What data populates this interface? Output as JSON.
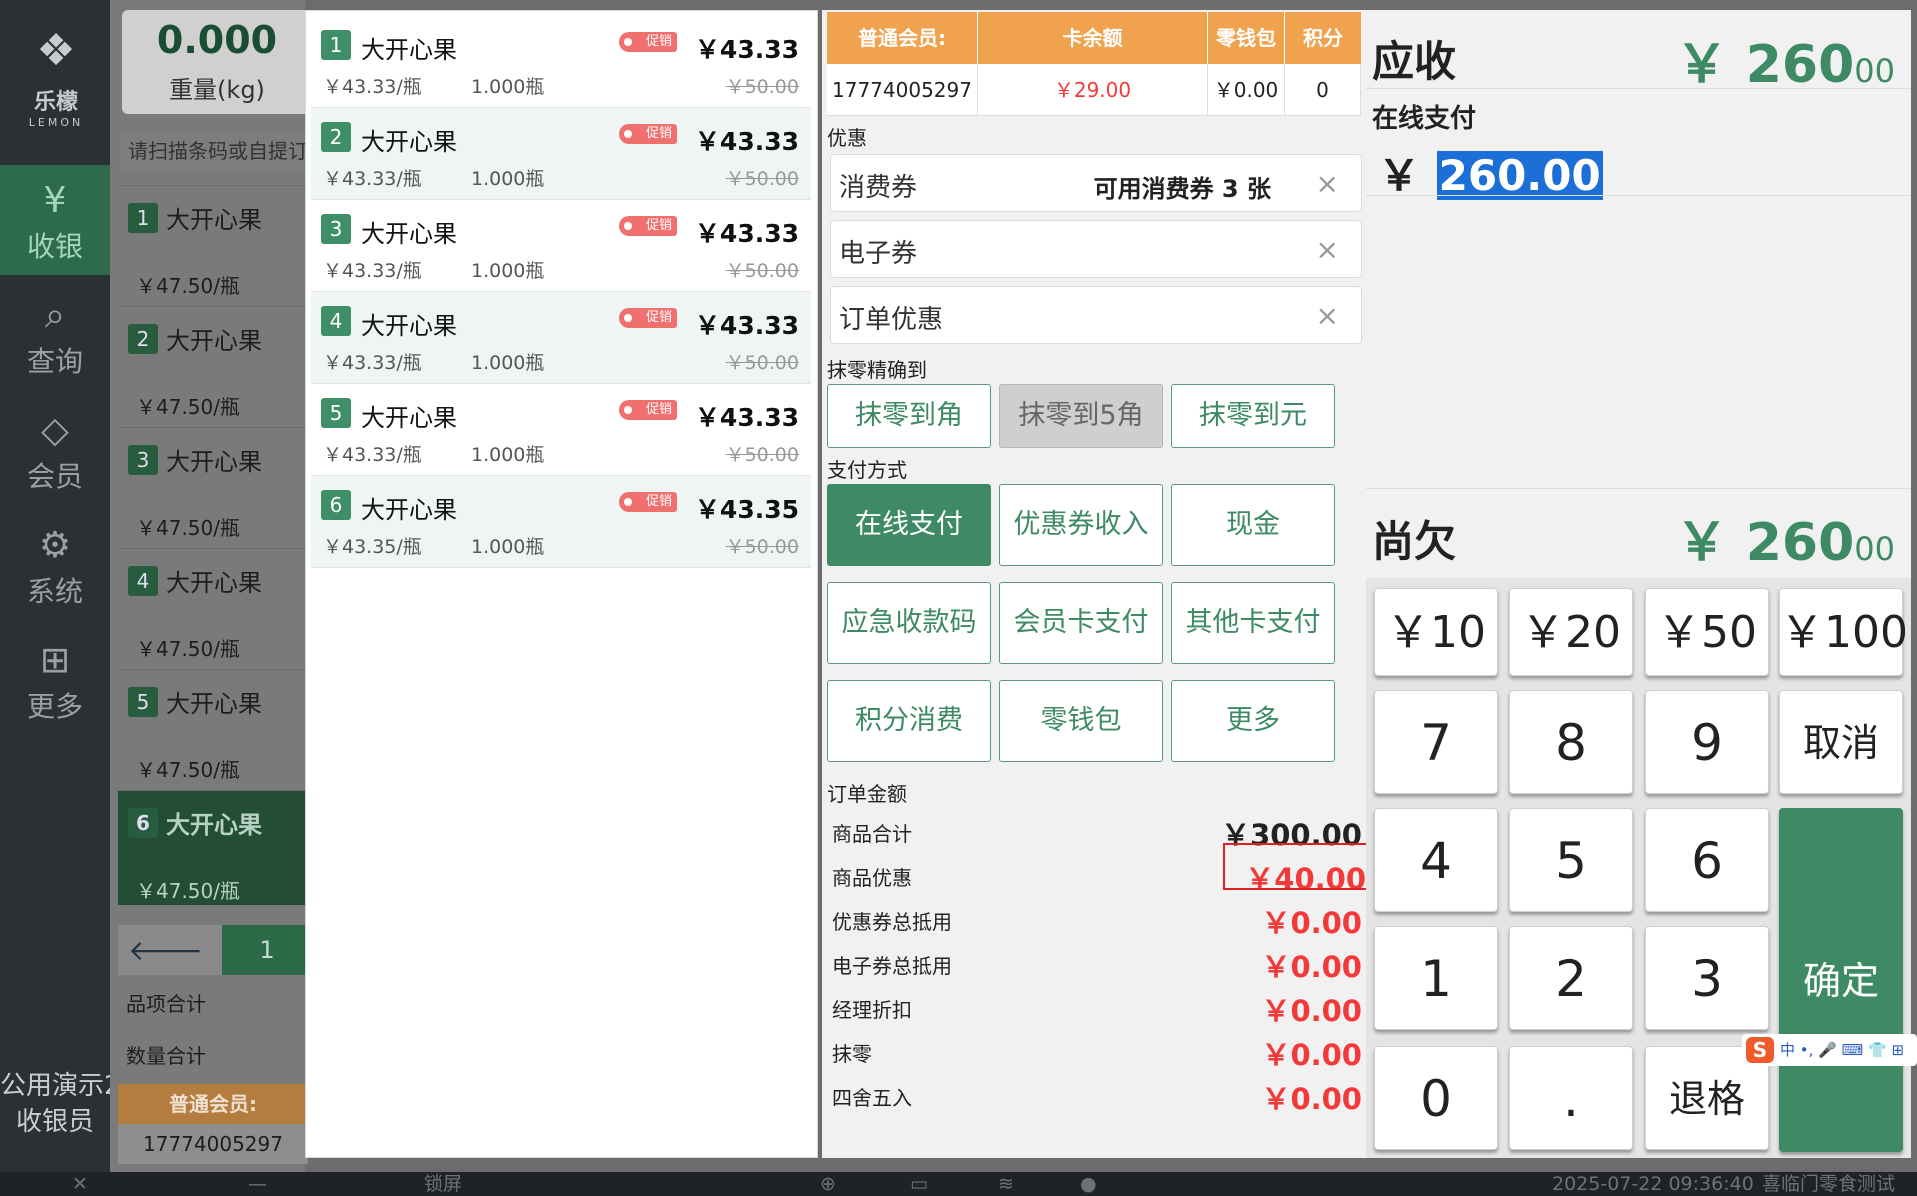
{
  "sidebar": {
    "logo_cn": "乐檬",
    "logo_en": "LEMON",
    "items": [
      {
        "label": "收银",
        "icon": "cashier-icon",
        "glyph": "¥",
        "active": true
      },
      {
        "label": "查询",
        "icon": "search-icon",
        "glyph": "⌕",
        "active": false
      },
      {
        "label": "会员",
        "icon": "diamond-icon",
        "glyph": "◇",
        "active": false
      },
      {
        "label": "系统",
        "icon": "gear-icon",
        "glyph": "⚙",
        "active": false
      },
      {
        "label": "更多",
        "icon": "grid-icon",
        "glyph": "⊞",
        "active": false
      }
    ],
    "store": "公用演示2",
    "role": "收银员"
  },
  "background": {
    "weight_value": "0.000",
    "weight_unit": "重量(kg)",
    "search_placeholder": "请扫描条码或自提订",
    "items": [
      {
        "no": "1",
        "name": "大开心果",
        "price": "￥47.50/瓶"
      },
      {
        "no": "2",
        "name": "大开心果",
        "price": "￥47.50/瓶"
      },
      {
        "no": "3",
        "name": "大开心果",
        "price": "￥47.50/瓶"
      },
      {
        "no": "4",
        "name": "大开心果",
        "price": "￥47.50/瓶"
      },
      {
        "no": "5",
        "name": "大开心果",
        "price": "￥47.50/瓶"
      },
      {
        "no": "6",
        "name": "大开心果",
        "price": "￥47.50/瓶"
      }
    ],
    "page": "1",
    "sum_items_label": "品项合计",
    "sum_qty_label": "数量合计",
    "member_label": "普通会员:",
    "member_phone": "17774005297"
  },
  "cart": [
    {
      "no": "1",
      "name": "大开心果",
      "tag": "促销",
      "price": "￥43.33",
      "unit": "￥43.33/瓶",
      "qty": "1.000瓶",
      "orig": "￥50.00"
    },
    {
      "no": "2",
      "name": "大开心果",
      "tag": "促销",
      "price": "￥43.33",
      "unit": "￥43.33/瓶",
      "qty": "1.000瓶",
      "orig": "￥50.00"
    },
    {
      "no": "3",
      "name": "大开心果",
      "tag": "促销",
      "price": "￥43.33",
      "unit": "￥43.33/瓶",
      "qty": "1.000瓶",
      "orig": "￥50.00"
    },
    {
      "no": "4",
      "name": "大开心果",
      "tag": "促销",
      "price": "￥43.33",
      "unit": "￥43.33/瓶",
      "qty": "1.000瓶",
      "orig": "￥50.00"
    },
    {
      "no": "5",
      "name": "大开心果",
      "tag": "促销",
      "price": "￥43.33",
      "unit": "￥43.33/瓶",
      "qty": "1.000瓶",
      "orig": "￥50.00"
    },
    {
      "no": "6",
      "name": "大开心果",
      "tag": "促销",
      "price": "￥43.35",
      "unit": "￥43.35/瓶",
      "qty": "1.000瓶",
      "orig": "￥50.00"
    }
  ],
  "member": {
    "headers": [
      "普通会员:",
      "卡余额",
      "零钱包",
      "积分"
    ],
    "values": [
      "17774005297",
      "￥29.00",
      "￥0.00",
      "0"
    ]
  },
  "discount": {
    "title": "优惠",
    "rows": [
      {
        "label": "消费券",
        "info": "可用消费券 3 张"
      },
      {
        "label": "电子券",
        "info": ""
      },
      {
        "label": "订单优惠",
        "info": ""
      }
    ],
    "close_glyph": "×"
  },
  "rounding": {
    "title": "抹零精确到",
    "options": [
      "抹零到角",
      "抹零到5角",
      "抹零到元"
    ]
  },
  "payment": {
    "title": "支付方式",
    "methods": [
      "在线支付",
      "优惠券收入",
      "现金",
      "应急收款码",
      "会员卡支付",
      "其他卡支付",
      "积分消费",
      "零钱包",
      "更多"
    ]
  },
  "order": {
    "title": "订单金额",
    "rows": [
      {
        "label": "商品合计",
        "value": "￥300.00"
      },
      {
        "label": "商品优惠",
        "value": "￥40.00"
      },
      {
        "label": "优惠券总抵用",
        "value": "￥0.00"
      },
      {
        "label": "电子券总抵用",
        "value": "￥0.00"
      },
      {
        "label": "经理折扣",
        "value": "￥0.00"
      },
      {
        "label": "抹零",
        "value": "￥0.00"
      },
      {
        "label": "四舍五入",
        "value": "￥0.00"
      }
    ]
  },
  "summary": {
    "receivable_label": "应收",
    "receivable_int": "￥ 260",
    "receivable_dec": "00",
    "online_label": "在线支付",
    "online_symbol": "￥",
    "online_value": "260.00",
    "owed_label": "尚欠",
    "owed_int": "￥ 260",
    "owed_dec": "00"
  },
  "keypad": {
    "quick": [
      "￥10",
      "￥20",
      "￥50",
      "￥100"
    ],
    "digits": [
      "7",
      "8",
      "9",
      "4",
      "5",
      "6",
      "1",
      "2",
      "3",
      "0",
      "."
    ],
    "cancel": "取消",
    "confirm": "确定",
    "backspace": "退格"
  },
  "ime": {
    "logo": "S",
    "text": "中 •, 🎤 ⌨ 👕 ⊞"
  },
  "taskbar": {
    "lock": "锁屏",
    "datetime": "2025-07-22 09:36:40",
    "store": "喜临门零食测试"
  },
  "colors": {
    "accent": "#3d8a64",
    "warning": "#f23a3a",
    "member_header": "#f0a24e"
  }
}
